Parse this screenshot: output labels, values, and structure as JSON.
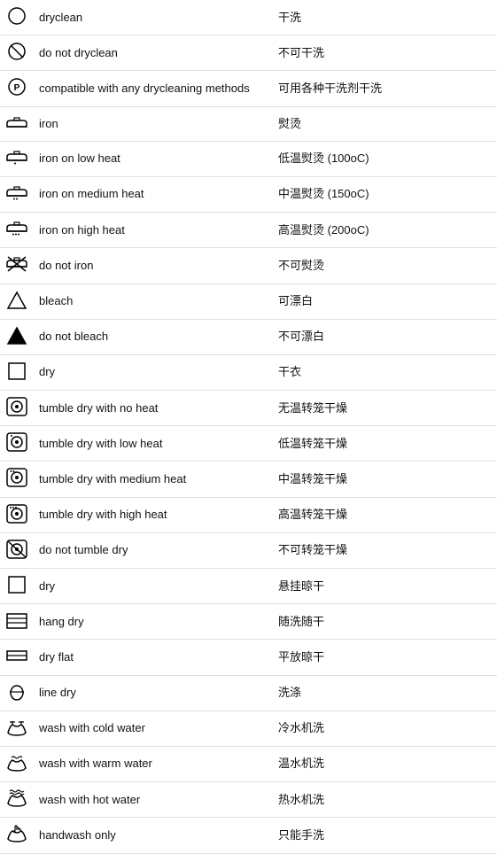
{
  "rows": [
    {
      "id": "dryclean",
      "label": "dryclean",
      "chinese": "干洗",
      "icon": "dryclean"
    },
    {
      "id": "do-not-dryclean",
      "label": "do not dryclean",
      "chinese": "不可干洗",
      "icon": "do-not-dryclean"
    },
    {
      "id": "compatible-dryclean",
      "label": "compatible with any drycleaning methods",
      "chinese": "可用各种干洗剂干洗",
      "icon": "compatible-dryclean"
    },
    {
      "id": "iron",
      "label": "iron",
      "chinese": "熨烫",
      "icon": "iron"
    },
    {
      "id": "iron-low",
      "label": "iron on low heat",
      "chinese": "低温熨烫 (100oC)",
      "icon": "iron-low"
    },
    {
      "id": "iron-medium",
      "label": "iron on medium heat",
      "chinese": "中温熨烫 (150oC)",
      "icon": "iron-medium"
    },
    {
      "id": "iron-high",
      "label": "iron on high heat",
      "chinese": "高温熨烫 (200oC)",
      "icon": "iron-high"
    },
    {
      "id": "do-not-iron",
      "label": "do not iron",
      "chinese": "不可熨烫",
      "icon": "do-not-iron"
    },
    {
      "id": "bleach",
      "label": "bleach",
      "chinese": "可漂白",
      "icon": "bleach"
    },
    {
      "id": "do-not-bleach",
      "label": "do not bleach",
      "chinese": "不可漂白",
      "icon": "do-not-bleach"
    },
    {
      "id": "dry",
      "label": "dry",
      "chinese": "干衣",
      "icon": "dry-square"
    },
    {
      "id": "tumble-no-heat",
      "label": "tumble dry with no heat",
      "chinese": "无温转笼干燥",
      "icon": "tumble-no-heat"
    },
    {
      "id": "tumble-low",
      "label": "tumble dry with low heat",
      "chinese": "低温转笼干燥",
      "icon": "tumble-low"
    },
    {
      "id": "tumble-medium",
      "label": "tumble dry with medium heat",
      "chinese": "中温转笼干燥",
      "icon": "tumble-medium"
    },
    {
      "id": "tumble-high",
      "label": "tumble dry with high heat",
      "chinese": "高温转笼干燥",
      "icon": "tumble-high"
    },
    {
      "id": "do-not-tumble",
      "label": "do not tumble dry",
      "chinese": "不可转笼干燥",
      "icon": "do-not-tumble"
    },
    {
      "id": "dry2",
      "label": "dry",
      "chinese": "悬挂晾干",
      "icon": "dry-square2"
    },
    {
      "id": "hang-dry",
      "label": "hang dry",
      "chinese": "随洗随干",
      "icon": "hang-dry"
    },
    {
      "id": "dry-flat",
      "label": "dry flat",
      "chinese": "平放晾干",
      "icon": "dry-flat"
    },
    {
      "id": "line-dry",
      "label": "line dry",
      "chinese": "洗涤",
      "icon": "line-dry"
    },
    {
      "id": "wash-cold",
      "label": "wash with cold water",
      "chinese": "冷水机洗",
      "icon": "wash-cold"
    },
    {
      "id": "wash-warm",
      "label": "wash with warm water",
      "chinese": "温水机洗",
      "icon": "wash-warm"
    },
    {
      "id": "wash-hot",
      "label": "wash with hot water",
      "chinese": "热水机洗",
      "icon": "wash-hot"
    },
    {
      "id": "handwash",
      "label": "handwash only",
      "chinese": "只能手洗",
      "icon": "handwash"
    }
  ]
}
